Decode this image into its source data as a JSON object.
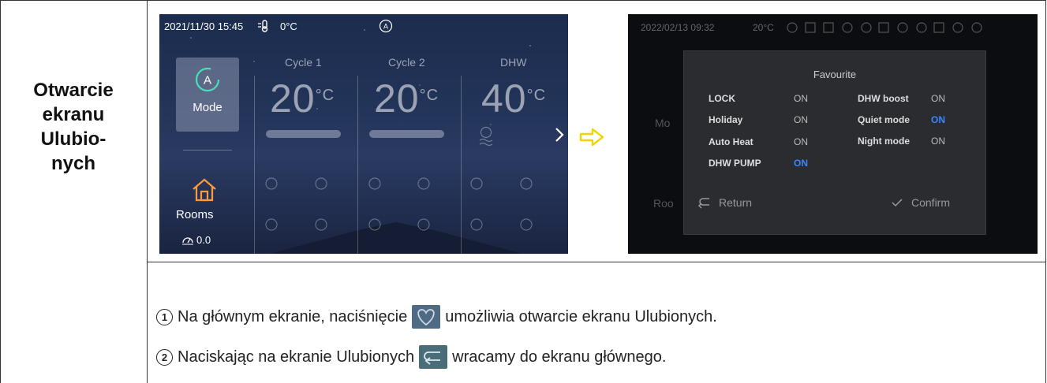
{
  "row_label": "Otwarcie ekranu Ulubio-nych",
  "row_label_lines": [
    "Otwarcie",
    "ekranu",
    "Ulubio-",
    "nych"
  ],
  "screen1": {
    "datetime": "2021/11/30 15:45",
    "temp": "0°C",
    "mode_label": "Mode",
    "rooms_label": "Rooms",
    "rooms_value": "0.0",
    "columns": [
      {
        "header": "Cycle 1",
        "temp": "20",
        "unit": "°C"
      },
      {
        "header": "Cycle 2",
        "temp": "20",
        "unit": "°C"
      },
      {
        "header": "DHW",
        "temp": "40",
        "unit": "°C"
      }
    ]
  },
  "screen2": {
    "datetime": "2022/02/13 09:32",
    "temp": "20°C",
    "dialog_title": "Favourite",
    "items": [
      {
        "label": "LOCK",
        "value": "ON",
        "on": false
      },
      {
        "label": "Holiday",
        "value": "ON",
        "on": false
      },
      {
        "label": "Auto Heat",
        "value": "ON",
        "on": false
      },
      {
        "label": "DHW PUMP",
        "value": "ON",
        "on": true
      },
      {
        "label": "DHW boost",
        "value": "ON",
        "on": false
      },
      {
        "label": "Quiet mode",
        "value": "ON",
        "on": true
      },
      {
        "label": "Night mode",
        "value": "ON",
        "on": false
      }
    ],
    "return_label": "Return",
    "confirm_label": "Confirm",
    "bg_mode_label": "Mo",
    "bg_rooms_label": "Roo"
  },
  "instructions": [
    {
      "num": "1",
      "before": "Na głównym ekranie, naciśnięcie",
      "after": "umożliwia otwarcie ekranu Ulubionych.",
      "icon": "heart-icon"
    },
    {
      "num": "2",
      "before": "Naciskając na ekranie Ulubionych",
      "after": "wracamy do ekranu głównego.",
      "icon": "return-icon"
    }
  ],
  "colors": {
    "accent_on": "#3b86ff",
    "arrow": "#f2d400",
    "icon_bg": "#4f6a85"
  }
}
